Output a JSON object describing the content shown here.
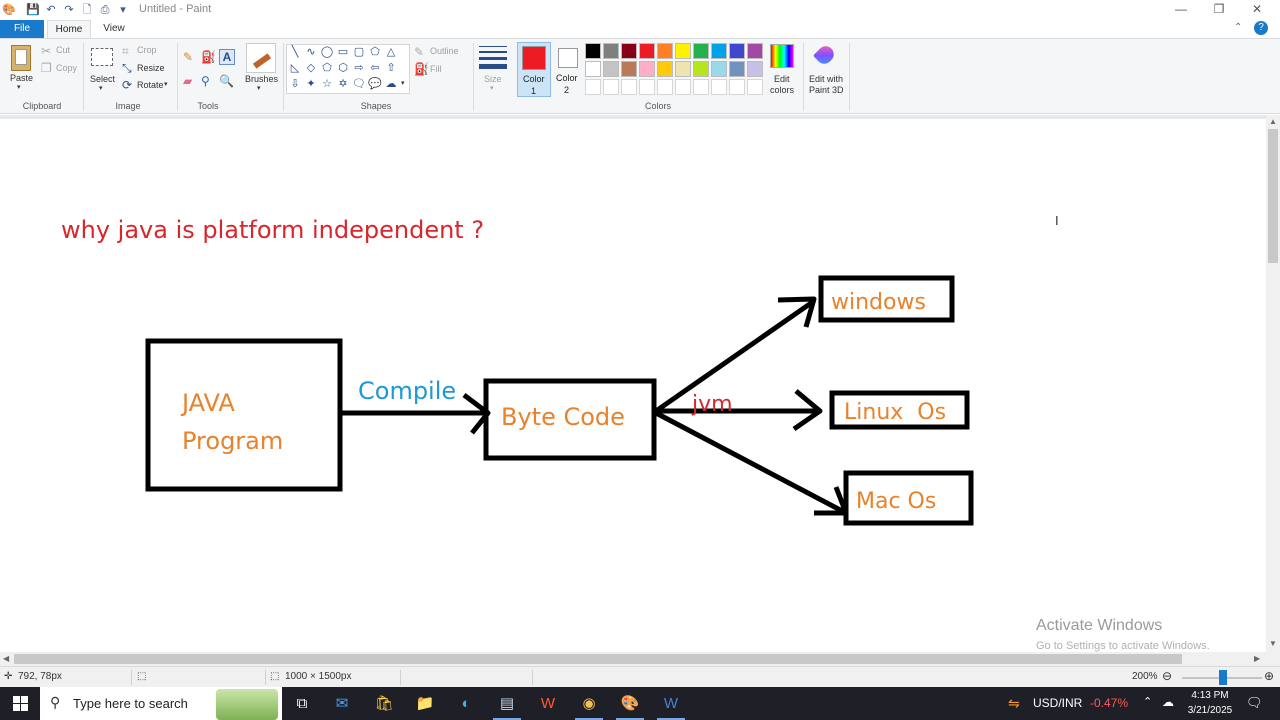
{
  "window": {
    "title": "Untitled - Paint",
    "controls": {
      "minimize": "—",
      "maximize": "❐",
      "close": "✕"
    }
  },
  "ribbon_tabs": [
    {
      "label": "File"
    },
    {
      "label": "Home"
    },
    {
      "label": "View"
    }
  ],
  "clipboard": {
    "paste": "Paste",
    "cut": "Cut",
    "copy": "Copy",
    "group": "Clipboard"
  },
  "image": {
    "select": "Select",
    "crop": "Crop",
    "resize": "Resize",
    "rotate": "Rotate",
    "group": "Image"
  },
  "tools": {
    "group": "Tools",
    "brushes": "Brushes"
  },
  "shapes": {
    "group": "Shapes",
    "outline": "Outline",
    "fill": "Fill"
  },
  "size": {
    "label": "Size"
  },
  "colors_group": {
    "color1": "Color\n1",
    "color1_a": "Color",
    "color1_b": "1",
    "color2_a": "Color",
    "color2_b": "2",
    "edit_a": "Edit",
    "edit_b": "colors",
    "paint3d_a": "Edit with",
    "paint3d_b": "Paint 3D",
    "group": "Colors",
    "color1_value": "#ed1c24",
    "color2_value": "#ffffff",
    "palette_row1": [
      "#000000",
      "#7f7f7f",
      "#880015",
      "#ed1c24",
      "#ff7f27",
      "#fff200",
      "#22b14c",
      "#00a2e8",
      "#3f48cc",
      "#a349a4"
    ],
    "palette_row2": [
      "#ffffff",
      "#c3c3c3",
      "#b97a57",
      "#ffaec9",
      "#ffc90e",
      "#efe4b0",
      "#b5e61d",
      "#99d9ea",
      "#7092be",
      "#c8bfe7"
    ]
  },
  "drawing": {
    "heading": "why java is platform independent ?",
    "box_java_line1": "JAVA",
    "box_java_line2": "Program",
    "compile": "Compile",
    "bytecode": "Byte Code",
    "jvm": "jvm",
    "windows": "windows",
    "linux": "Linux  Os",
    "mac": "Mac Os",
    "heading_color": "#d9262c",
    "box_text_color": "#e8822c",
    "compile_color": "#1b9ad6",
    "jvm_color": "#d9262c"
  },
  "watermark": {
    "line1": "Activate Windows",
    "line2": "Go to Settings to activate Windows."
  },
  "status": {
    "cursor_pos": "792, 78px",
    "image_size": "1000 × 1500px",
    "zoom": "200%"
  },
  "taskbar": {
    "search_placeholder": "Type here to search",
    "ticker_label": "USD/INR",
    "ticker_value": "-0.47%",
    "time": "4:13 PM",
    "date": "3/21/2025"
  }
}
